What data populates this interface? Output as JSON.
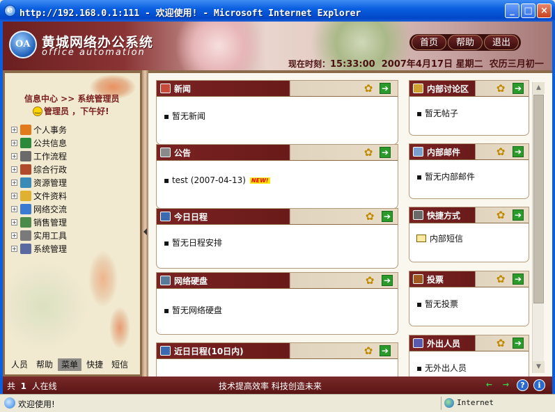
{
  "window": {
    "title": "http://192.168.0.1:111 - 欢迎使用! - Microsoft Internet Explorer",
    "min_symbol": "_",
    "max_symbol": "□",
    "close_symbol": "×"
  },
  "header": {
    "system_name": "黄城网络办公系统",
    "system_subname": "office automation",
    "nav": [
      "首页",
      "帮助",
      "退出"
    ],
    "time_label": "现在时刻：",
    "time": "15:33:00",
    "date": "2007年4月17日",
    "weekday": "星期二",
    "lunar": "农历三月初一"
  },
  "sidebar": {
    "breadcrumb": "信息中心 >> 系统管理员",
    "greeting": "管理员 ，下午好!",
    "menu": [
      {
        "label": "个人事务",
        "icon": "personal-icon",
        "color": "#e07a1a"
      },
      {
        "label": "公共信息",
        "icon": "globe-info-icon",
        "color": "#2a8a3a"
      },
      {
        "label": "工作流程",
        "icon": "workflow-icon",
        "color": "#6a6a6a"
      },
      {
        "label": "综合行政",
        "icon": "admin-icon",
        "color": "#b04a2a"
      },
      {
        "label": "资源管理",
        "icon": "resource-icon",
        "color": "#3a8ab8"
      },
      {
        "label": "文件资料",
        "icon": "folder-icon",
        "color": "#e0b030"
      },
      {
        "label": "网络交流",
        "icon": "network-icon",
        "color": "#3a7ad0"
      },
      {
        "label": "销售管理",
        "icon": "sales-icon",
        "color": "#4a8a4a"
      },
      {
        "label": "实用工具",
        "icon": "tools-icon",
        "color": "#7a7a7a"
      },
      {
        "label": "系统管理",
        "icon": "system-icon",
        "color": "#5a6aa0"
      }
    ],
    "bottom_tabs": [
      "人员",
      "帮助",
      "菜单",
      "快捷",
      "短信"
    ],
    "active_tab": "菜单"
  },
  "panels_left": [
    {
      "title": "新闻",
      "icon": "news-icon",
      "body": "▪ 暂无新闻"
    },
    {
      "title": "公告",
      "icon": "announcement-icon",
      "body": "▪ test (2007-04-13)",
      "badge": "NEW!"
    },
    {
      "title": "今日日程",
      "icon": "calendar-icon",
      "body": "▪ 暂无日程安排"
    },
    {
      "title": "网络硬盘",
      "icon": "disk-icon",
      "body": "▪ 暂无网络硬盘"
    },
    {
      "title": "近日日程(10日内)",
      "icon": "calendar-icon",
      "body": ""
    }
  ],
  "panels_right": [
    {
      "title": "内部讨论区",
      "icon": "forum-icon",
      "body": "▪ 暂无帖子"
    },
    {
      "title": "内部邮件",
      "icon": "mail-icon",
      "body": "▪ 暂无内部邮件"
    },
    {
      "title": "快捷方式",
      "icon": "shortcut-icon",
      "body": "内部短信"
    },
    {
      "title": "投票",
      "icon": "vote-icon",
      "body": "▪ 暂无投票"
    },
    {
      "title": "外出人员",
      "icon": "out-people-icon",
      "body": "▪ 无外出人员"
    }
  ],
  "panel_icons": {
    "gear": "✿",
    "arrow": "➔"
  },
  "footer": {
    "online_prefix": "共",
    "online_count": "1",
    "online_suffix": "人在线",
    "slogan": "技术提高效率   科技创造未来",
    "icons": [
      "←",
      "→",
      "?",
      "i"
    ]
  },
  "statusbar": {
    "text": "欢迎使用!",
    "zone": "Internet"
  },
  "colors": {
    "accent": "#6a1a1a",
    "frame": "#0a5fe0",
    "panel_border": "#b49a7c"
  }
}
